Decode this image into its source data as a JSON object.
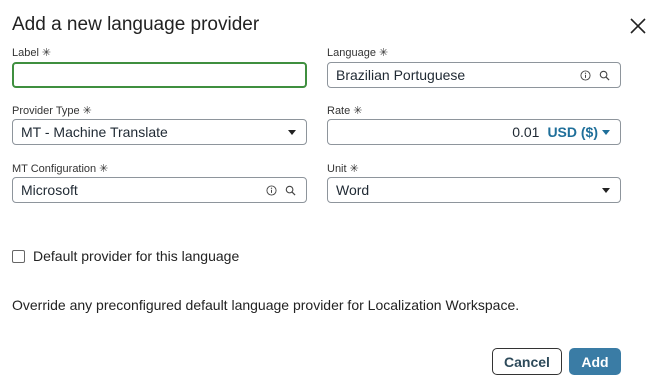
{
  "dialog": {
    "title": "Add a new language provider",
    "close_icon": "close-icon"
  },
  "fields": {
    "label": {
      "label": "Label",
      "required": "✳",
      "value": "",
      "placeholder": ""
    },
    "language": {
      "label": "Language",
      "required": "✳",
      "value": "Brazilian Portuguese"
    },
    "provider_type": {
      "label": "Provider Type",
      "required": "✳",
      "value": "MT - Machine Translate"
    },
    "rate": {
      "label": "Rate",
      "required": "✳",
      "amount": "0.01",
      "currency": "USD ($)"
    },
    "mt_configuration": {
      "label": "MT Configuration",
      "required": "✳",
      "value": "Microsoft"
    },
    "unit": {
      "label": "Unit",
      "required": "✳",
      "value": "Word"
    }
  },
  "default_provider": {
    "label": "Default provider for this language",
    "checked": false
  },
  "note": "Override any preconfigured default language provider for Localization Workspace.",
  "buttons": {
    "cancel": "Cancel",
    "add": "Add"
  },
  "colors": {
    "accent": "#3a7ca5",
    "focus": "#3f8f3f",
    "link": "#1f6f9a"
  }
}
